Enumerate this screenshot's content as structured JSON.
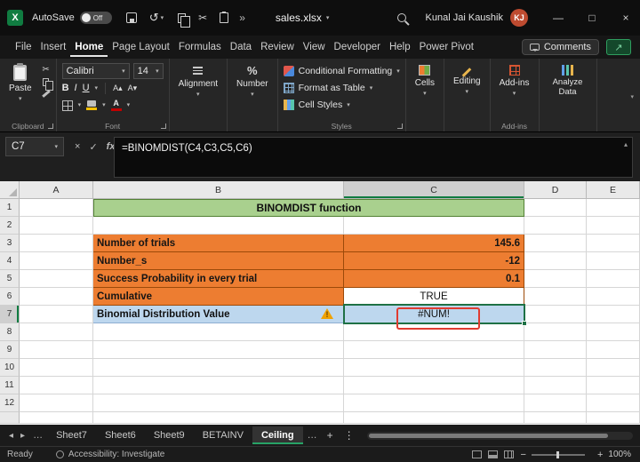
{
  "icons": {
    "caret_down": "▾",
    "caret_up": "▴",
    "cancel": "×",
    "check": "✓",
    "fx": "fx",
    "undo": "↺",
    "scissors": "✂",
    "overflow": "»",
    "ellipsis": "…",
    "kebab": "⋮",
    "plus": "+",
    "minus": "−",
    "nav_left": "◂",
    "nav_right": "▸",
    "minimize": "—",
    "maximize": "□",
    "close": "×",
    "share_arrow": "↗",
    "exclaim": "!",
    "percent": "%",
    "bold": "B",
    "italic": "I",
    "underline": "U",
    "font_grow": "A▴",
    "font_shrink": "A▾",
    "font_color": "A",
    "logo": "X"
  },
  "titlebar": {
    "autosave_label": "AutoSave",
    "autosave_state": "Off",
    "filename": "sales.xlsx",
    "user_name": "Kunal Jai Kaushik",
    "user_initials": "KJ"
  },
  "menubar": {
    "items": [
      "File",
      "Insert",
      "Home",
      "Page Layout",
      "Formulas",
      "Data",
      "Review",
      "View",
      "Developer",
      "Help",
      "Power Pivot"
    ],
    "active": "Home",
    "comments_label": "Comments"
  },
  "ribbon": {
    "paste": "Paste",
    "font_name": "Calibri",
    "font_size": "14",
    "alignment": "Alignment",
    "number": "Number",
    "styles": [
      "Conditional Formatting",
      "Format as Table",
      "Cell Styles"
    ],
    "cells": "Cells",
    "editing": "Editing",
    "addins": "Add-ins",
    "analyze": "Analyze Data",
    "labels": {
      "clipboard": "Clipboard",
      "font": "Font",
      "styles": "Styles",
      "addins": "Add-ins"
    }
  },
  "formula_bar": {
    "name_box": "C7",
    "formula": "=BINOMDIST(C4,C3,C5,C6)"
  },
  "grid": {
    "columns": [
      "A",
      "B",
      "C",
      "D",
      "E"
    ],
    "rows": [
      "1",
      "2",
      "3",
      "4",
      "5",
      "6",
      "7",
      "8",
      "9",
      "10",
      "11",
      "12"
    ],
    "title_cell": "BINOMDIST function",
    "cells": [
      {
        "label": "Number of trials",
        "value": "145.6"
      },
      {
        "label": "Number_s",
        "value": "-12"
      },
      {
        "label": "Success Probability in every trial",
        "value": "0.1"
      },
      {
        "label": "Cumulative",
        "value": "TRUE"
      },
      {
        "label": "Binomial Distribution Value",
        "value": "#NUM!"
      }
    ],
    "active_cell": "C7"
  },
  "sheet_tabs": {
    "tabs": [
      "Sheet7",
      "Sheet6",
      "Sheet9",
      "BETAINV",
      "Ceiling"
    ],
    "active": "Ceiling"
  },
  "status_bar": {
    "ready": "Ready",
    "accessibility": "Accessibility: Investigate",
    "zoom": "100%"
  },
  "colors": {
    "accent_green": "#107C41",
    "title_cell_green": "#A9D08E",
    "orange": "#ED7D31",
    "light_blue": "#BDD7EE",
    "error_red": "#E03C31"
  }
}
